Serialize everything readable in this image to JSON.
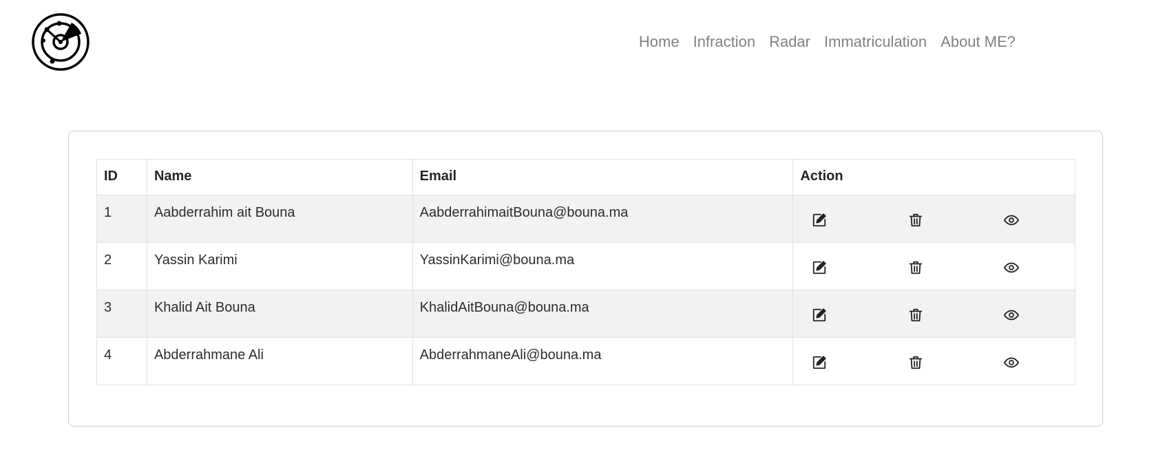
{
  "header": {
    "logo": "radar-logo-icon",
    "nav": [
      {
        "label": "Home"
      },
      {
        "label": "Infraction"
      },
      {
        "label": "Radar"
      },
      {
        "label": "Immatriculation"
      },
      {
        "label": "About ME?"
      }
    ]
  },
  "table": {
    "columns": [
      "ID",
      "Name",
      "Email",
      "Action"
    ],
    "rows": [
      {
        "id": "1",
        "name": "Aabderrahim ait Bouna",
        "email": "AabderrahimaitBouna@bouna.ma"
      },
      {
        "id": "2",
        "name": "Yassin Karimi",
        "email": "YassinKarimi@bouna.ma"
      },
      {
        "id": "3",
        "name": "Khalid Ait Bouna",
        "email": "KhalidAitBouna@bouna.ma"
      },
      {
        "id": "4",
        "name": "Abderrahmane Ali",
        "email": "AbderrahmaneAli@bouna.ma"
      }
    ],
    "action_icons": [
      "edit-icon",
      "trash-icon",
      "eye-icon"
    ],
    "striped_color": "#f2f2f2"
  }
}
